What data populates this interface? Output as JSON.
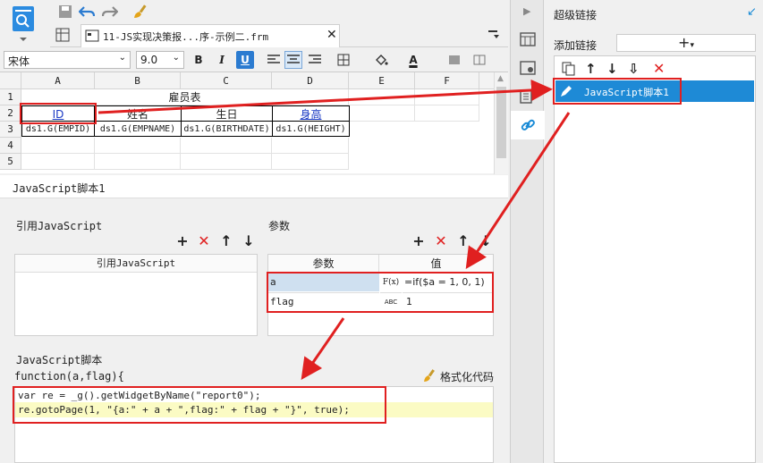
{
  "toolbar": {
    "file_tab_label": "11-JS实现决策报...序-示例二.frm"
  },
  "format": {
    "font_name": "宋体",
    "font_size": "9.0",
    "bold": "B",
    "italic": "I",
    "underline": "U",
    "font_color_label": "A"
  },
  "sheet": {
    "columns": [
      "A",
      "B",
      "C",
      "D",
      "E",
      "F"
    ],
    "rows": [
      "1",
      "2",
      "3",
      "4",
      "5"
    ],
    "title": "雇员表",
    "headers": [
      "ID",
      "姓名",
      "生日",
      "身高"
    ],
    "formulas": [
      "ds1.G(EMPID)",
      "ds1.G(EMPNAME)",
      "ds1.G(BIRTHDATE)",
      "ds1.G(HEIGHT)"
    ]
  },
  "panel": {
    "title": "JavaScript脚本1",
    "ref_js_label": "引用JavaScript",
    "ref_js_column": "引用JavaScript",
    "params_label": "参数",
    "params_col_name": "参数",
    "params_col_value": "值",
    "params": [
      {
        "name": "a",
        "type_icon": "F(x)",
        "value": "=if($a = 1, 0, 1)"
      },
      {
        "name": "flag",
        "type_icon": "ABC",
        "value": "1"
      }
    ],
    "script_label": "JavaScript脚本",
    "function_sig": "function(a,flag){",
    "format_code_label": "格式化代码",
    "code_line1": "var re = _g().getWidgetByName(\"report0\");",
    "code_line2": "re.gotoPage(1, \"{a:\" + a + \",flag:\" + flag + \"}\", true);"
  },
  "right": {
    "title": "超级链接",
    "add_link_label": "添加链接",
    "add_button": "+",
    "link_item": "JavaScript脚本1"
  },
  "colors": {
    "accent": "#1a8bd6",
    "highlight_red": "#e02020",
    "selected_bg": "#1e8ad6"
  }
}
